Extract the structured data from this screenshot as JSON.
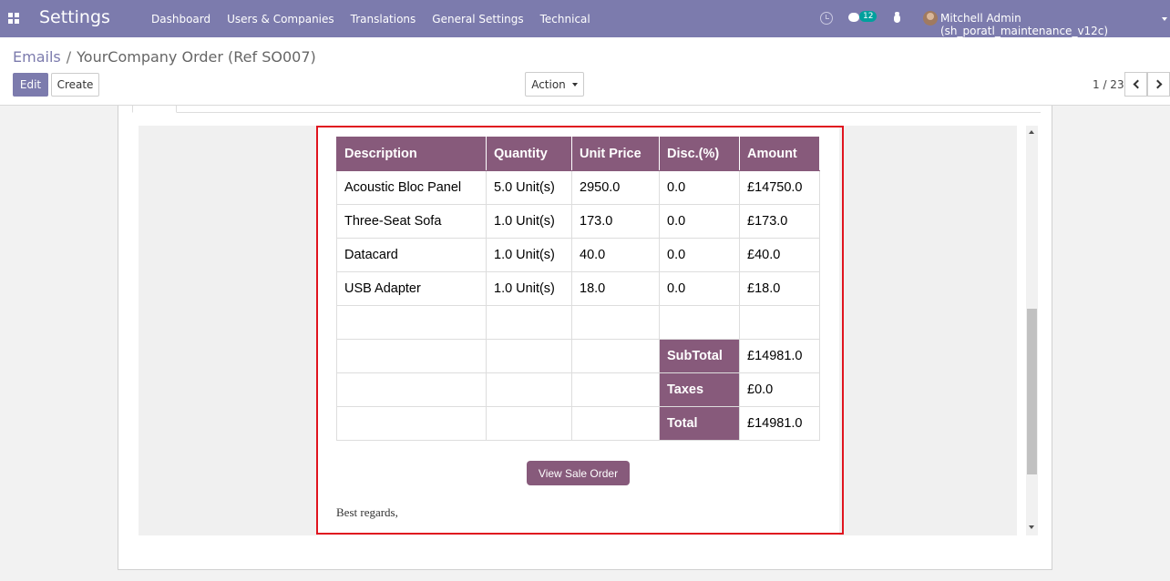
{
  "navbar": {
    "app_title": "Settings",
    "menu": [
      "Dashboard",
      "Users & Companies",
      "Translations",
      "General Settings",
      "Technical"
    ],
    "chat_count": "12",
    "user_name": "Mitchell Admin (sh_poratl_maintenance_v12c)"
  },
  "breadcrumb": {
    "parent": "Emails",
    "separator": "/",
    "current": "YourCompany Order (Ref SO007)"
  },
  "buttons": {
    "edit": "Edit",
    "create": "Create",
    "action": "Action"
  },
  "pager": {
    "value": "1 / 23"
  },
  "order_table": {
    "headers": [
      "Description",
      "Quantity",
      "Unit Price",
      "Disc.(%)",
      "Amount"
    ],
    "rows": [
      [
        "Acoustic Bloc Panel",
        "5.0 Unit(s)",
        "2950.0",
        "0.0",
        "£14750.0"
      ],
      [
        "Three-Seat Sofa",
        "1.0 Unit(s)",
        "173.0",
        "0.0",
        "£173.0"
      ],
      [
        "Datacard",
        "1.0 Unit(s)",
        "40.0",
        "0.0",
        "£40.0"
      ],
      [
        "USB Adapter",
        "1.0 Unit(s)",
        "18.0",
        "0.0",
        "£18.0"
      ]
    ],
    "totals": [
      {
        "label": "SubTotal",
        "value": "£14981.0"
      },
      {
        "label": "Taxes",
        "value": "£0.0"
      },
      {
        "label": "Total",
        "value": "£14981.0"
      }
    ]
  },
  "email": {
    "view_button": "View Sale Order",
    "closing": "Best regards,"
  },
  "colors": {
    "navbar": "#7c7bad",
    "table_header": "#875a7b",
    "highlight": "#e0141f"
  }
}
